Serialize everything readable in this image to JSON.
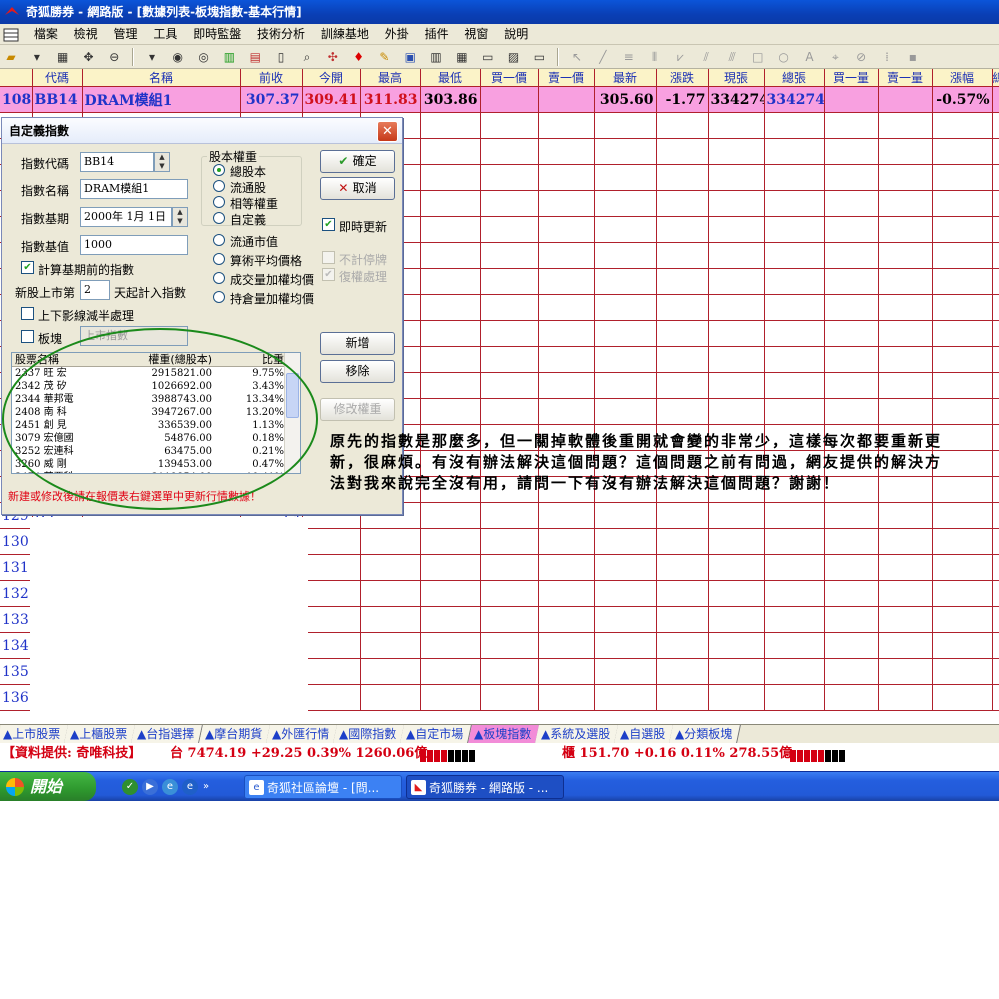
{
  "window_title": "奇狐勝券 - 網路版 - [數據列表-板塊指數-基本行情]",
  "menu": [
    "檔案",
    "檢視",
    "管理",
    "工具",
    "即時監盤",
    "技術分析",
    "訓練基地",
    "外掛",
    "插件",
    "視窗",
    "說明"
  ],
  "grid": {
    "headers": [
      "",
      "代碼",
      "名稱",
      "前收",
      "今開",
      "最高",
      "最低",
      "買一價",
      "賣一價",
      "最新",
      "漲跌",
      "現張",
      "總張",
      "買一量",
      "賣一量",
      "漲幅",
      "總"
    ],
    "selected_row": {
      "idx": "108",
      "code": "BB14",
      "name": "DRAM模組1",
      "prev_close": "307.37",
      "open": "309.41",
      "high": "311.83",
      "low": "303.86",
      "bid": "",
      "ask": "",
      "last": "305.60",
      "change": "-1.77",
      "cur_vol": "334274",
      "tot_vol": "334274",
      "bid_vol": "",
      "ask_vol": "",
      "pct": "-0.57%"
    },
    "partial_rows": [
      {
        "idx": "1",
        "code": "BB33",
        "val": ""
      },
      {
        "idx": "128",
        "code": "",
        "val": ""
      },
      {
        "idx": "129",
        "code": "B3",
        "val": "19"
      },
      {
        "idx": "130",
        "code": "",
        "val": ""
      },
      {
        "idx": "131",
        "code": "",
        "val": ""
      },
      {
        "idx": "132",
        "code": "",
        "val": "98"
      },
      {
        "idx": "133",
        "code": "",
        "val": ""
      },
      {
        "idx": "134",
        "code": "40",
        "val": "60"
      },
      {
        "idx": "135",
        "code": "",
        "val": ""
      },
      {
        "idx": "136",
        "code": "",
        "val": ""
      }
    ]
  },
  "dialog": {
    "title": "自定義指數",
    "close_icon": "close-icon",
    "index_code_label": "指數代碼",
    "index_code": "BB14",
    "index_name_label": "指數名稱",
    "index_name": "DRAM模組1",
    "base_date_label": "指數基期",
    "base_date": "2000年  1月  1日",
    "base_value_label": "指數基值",
    "base_value": "1000",
    "calc_before_base": "計算基期前的指數",
    "new_listing_prefix": "新股上市第",
    "new_listing_days": "2",
    "new_listing_suffix": "天起計入指數",
    "shadow_half": "上下影線減半處理",
    "sector_label": "板塊",
    "sector_value": "上市指數",
    "weight_group_title": "股本權重",
    "weight_options": [
      "總股本",
      "流通股",
      "相等權重",
      "自定義"
    ],
    "other_options": [
      "流通市值",
      "算術平均價格",
      "成交量加權均價",
      "持倉量加權均價"
    ],
    "ok": "確定",
    "cancel": "取消",
    "realtime_update": "即時更新",
    "exclude_suspended": "不計停牌",
    "rights_adjust": "復權處理",
    "add": "新增",
    "remove": "移除",
    "edit_weight": "修改權重",
    "list_headers": [
      "股票名稱",
      "權重(總股本)",
      "比重"
    ],
    "list_rows": [
      {
        "name": "2337 旺  宏",
        "weight": "2915821.00",
        "pct": "9.75%"
      },
      {
        "name": "2342 茂  矽",
        "weight": "1026692.00",
        "pct": "3.43%"
      },
      {
        "name": "2344 華邦電",
        "weight": "3988743.00",
        "pct": "13.34%"
      },
      {
        "name": "2408 南  科",
        "weight": "3947267.00",
        "pct": "13.20%"
      },
      {
        "name": "2451 創  見",
        "weight": "336539.00",
        "pct": "1.13%"
      },
      {
        "name": "3079 宏億國",
        "weight": "54876.00",
        "pct": "0.18%"
      },
      {
        "name": "3252 宏連科",
        "weight": "63475.00",
        "pct": "0.21%"
      },
      {
        "name": "3260 威  剛",
        "weight": "139453.00",
        "pct": "0.47%"
      },
      {
        "name": "3474 華亞科",
        "weight": "3119854.00",
        "pct": "10.41%"
      }
    ],
    "hint": "新建或修改後請在報價表右鍵選單中更新行情數據！"
  },
  "note": "原先的指數是那麼多，但一關掉軟體後重開就會變的非常少，這樣每次都要重新更新，很麻煩。有沒有辦法解決這個問題？這個問題之前有問過，網友提供的解決方法對我來說完全沒有用，請問一下有沒有辦法解決這個問題？謝謝！",
  "tabs": [
    "▲上市股票",
    "▲上櫃股票",
    "▲台指選擇",
    "▲摩台期貨",
    "▲外匯行情",
    "▲國際指數",
    "▲自定市場",
    "▲板塊指數",
    "▲系統及選股",
    "▲自選股",
    "▲分類板塊"
  ],
  "active_tab": "▲板塊指數",
  "status": {
    "provider": "【資料提供: 奇唯科技】",
    "twse": "台 7474.19 +29.25 0.39% 1260.06億",
    "otc": "櫃 151.70 +0.16 0.11% 278.55億"
  },
  "taskbar": {
    "start": "開始",
    "tasks": [
      "奇狐社區論壇 - [問...",
      "奇狐勝券 - 網路版 - ..."
    ]
  },
  "colors": {
    "accent_pink": "#f8a0e0",
    "grid_line": "#b0202c",
    "header_blue": "#1a2fb4"
  }
}
